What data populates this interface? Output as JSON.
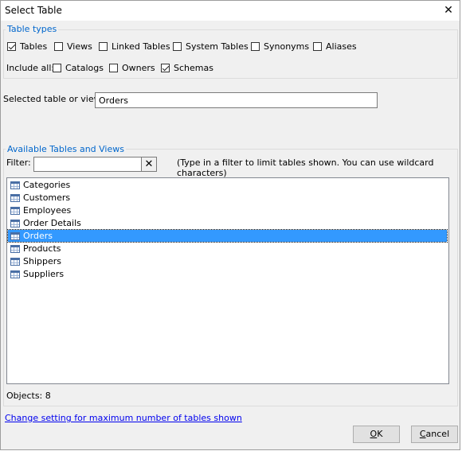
{
  "window": {
    "title": "Select Table",
    "close_glyph": "✕"
  },
  "table_types": {
    "legend": "Table types",
    "options": [
      {
        "label": "Tables",
        "checked": true
      },
      {
        "label": "Views",
        "checked": false
      },
      {
        "label": "Linked Tables",
        "checked": false
      },
      {
        "label": "System Tables",
        "checked": false
      },
      {
        "label": "Synonyms",
        "checked": false
      },
      {
        "label": "Aliases",
        "checked": false
      }
    ],
    "include_all_label": "Include all:",
    "include_options": [
      {
        "label": "Catalogs",
        "checked": false
      },
      {
        "label": "Owners",
        "checked": false
      },
      {
        "label": "Schemas",
        "checked": true
      }
    ]
  },
  "selected": {
    "label": "Selected table or view:",
    "value": "Orders"
  },
  "available": {
    "legend": "Available Tables and Views",
    "filter_label": "Filter:",
    "filter_value": "",
    "filter_clear_glyph": "✕",
    "filter_hint": "(Type in a filter to limit tables shown. You can use wildcard characters)",
    "items": [
      "Categories",
      "Customers",
      "Employees",
      "Order Details",
      "Orders",
      "Products",
      "Shippers",
      "Suppliers"
    ],
    "selected_index": 4,
    "objects_text": "Objects: 8"
  },
  "footer": {
    "link_text": "Change setting for maximum number of tables shown",
    "ok_prefix": "",
    "ok_underlined": "O",
    "ok_rest": "K",
    "cancel_prefix": "",
    "cancel_underlined": "C",
    "cancel_rest": "ancel"
  }
}
